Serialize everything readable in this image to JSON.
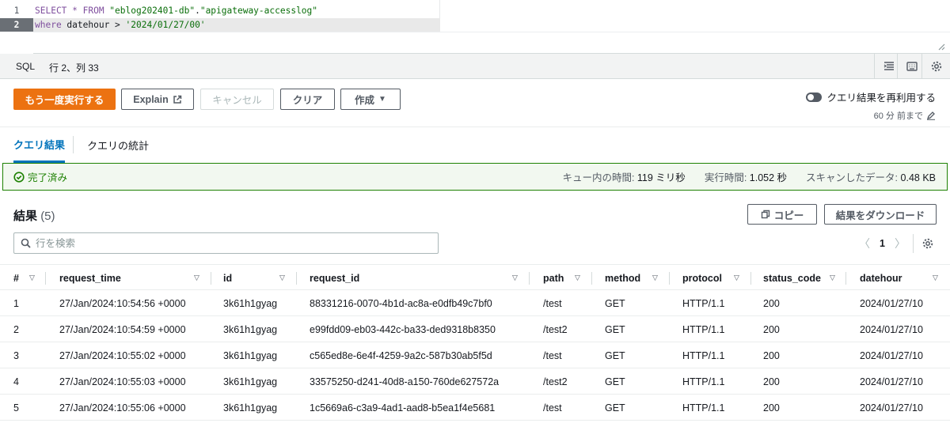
{
  "editor": {
    "lines": [
      {
        "num": "1",
        "parts": [
          {
            "t": "SELECT * FROM ",
            "c": "kw"
          },
          {
            "t": "\"eblog202401-db\"",
            "c": "str"
          },
          {
            "t": ".",
            "c": "ident"
          },
          {
            "t": "\"apigateway-accesslog\"",
            "c": "str"
          }
        ]
      },
      {
        "num": "2",
        "parts": [
          {
            "t": "where",
            "c": "kw"
          },
          {
            "t": " datehour > ",
            "c": "ident"
          },
          {
            "t": "'2024/01/27/00'",
            "c": "str"
          }
        ]
      }
    ]
  },
  "statusbar": {
    "language": "SQL",
    "position": "行 2、列 33"
  },
  "actions": {
    "run_again": "もう一度実行する",
    "explain": "Explain",
    "cancel": "キャンセル",
    "clear": "クリア",
    "create": "作成"
  },
  "reuse": {
    "label": "クエリ結果を再利用する",
    "age": "60 分 前まで"
  },
  "tabs": {
    "results": "クエリ結果",
    "stats": "クエリの統計"
  },
  "banner": {
    "status": "完了済み",
    "queue_label": "キュー内の時間:",
    "queue_value": "119 ミリ秒",
    "exec_label": "実行時間:",
    "exec_value": "1.052 秒",
    "scanned_label": "スキャンしたデータ:",
    "scanned_value": "0.48 KB"
  },
  "results": {
    "title": "結果",
    "count": "(5)",
    "copy": "コピー",
    "download": "結果をダウンロード",
    "search_placeholder": "行を検索",
    "page": "1"
  },
  "table": {
    "columns": [
      "#",
      "request_time",
      "id",
      "request_id",
      "path",
      "method",
      "protocol",
      "status_code",
      "datehour"
    ],
    "rows": [
      [
        "1",
        "27/Jan/2024:10:54:56 +0000",
        "3k61h1gyag",
        "88331216-0070-4b1d-ac8a-e0dfb49c7bf0",
        "/test",
        "GET",
        "HTTP/1.1",
        "200",
        "2024/01/27/10"
      ],
      [
        "2",
        "27/Jan/2024:10:54:59 +0000",
        "3k61h1gyag",
        "e99fdd09-eb03-442c-ba33-ded9318b8350",
        "/test2",
        "GET",
        "HTTP/1.1",
        "200",
        "2024/01/27/10"
      ],
      [
        "3",
        "27/Jan/2024:10:55:02 +0000",
        "3k61h1gyag",
        "c565ed8e-6e4f-4259-9a2c-587b30ab5f5d",
        "/test",
        "GET",
        "HTTP/1.1",
        "200",
        "2024/01/27/10"
      ],
      [
        "4",
        "27/Jan/2024:10:55:03 +0000",
        "3k61h1gyag",
        "33575250-d241-40d8-a150-760de627572a",
        "/test2",
        "GET",
        "HTTP/1.1",
        "200",
        "2024/01/27/10"
      ],
      [
        "5",
        "27/Jan/2024:10:55:06 +0000",
        "3k61h1gyag",
        "1c5669a6-c3a9-4ad1-aad8-b5ea1f4e5681",
        "/test",
        "GET",
        "HTTP/1.1",
        "200",
        "2024/01/27/10"
      ]
    ]
  },
  "colors": {
    "primary": "#ec7211",
    "link": "#0073bb",
    "success": "#1d8102"
  }
}
